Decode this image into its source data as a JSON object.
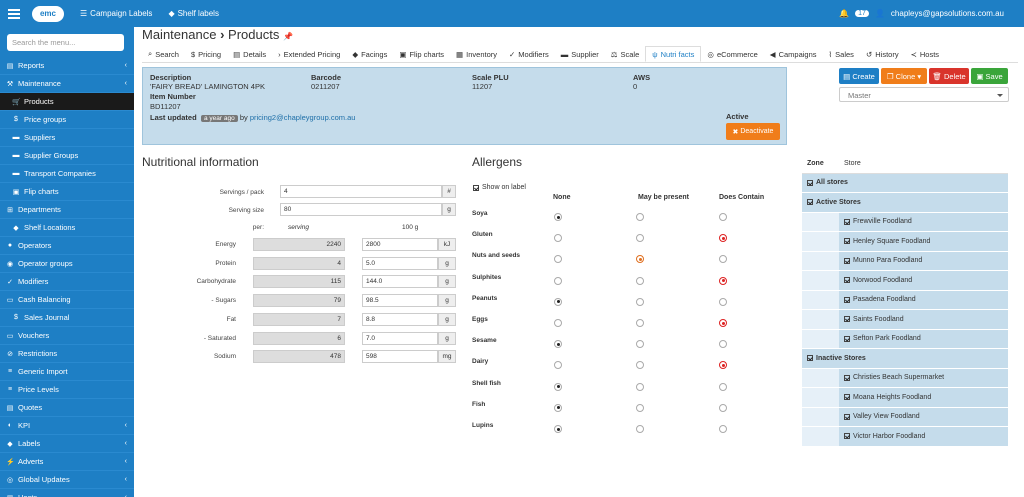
{
  "topbar": {
    "campaign_labels": "Campaign Labels",
    "shelf_labels": "Shelf labels",
    "notif_count": "17",
    "user_email": "chapleys@gapsolutions.com.au",
    "logo": "emc"
  },
  "sidebar": {
    "search_placeholder": "Search the menu...",
    "items": [
      {
        "label": "Reports",
        "icon": "file-icon",
        "arrow": true,
        "sub": false
      },
      {
        "label": "Maintenance",
        "icon": "wrench-icon",
        "arrow": true,
        "sub": false
      },
      {
        "label": "Products",
        "icon": "cart-icon",
        "arrow": false,
        "sub": true,
        "active": true
      },
      {
        "label": "Price groups",
        "icon": "dollar-icon",
        "arrow": false,
        "sub": true
      },
      {
        "label": "Suppliers",
        "icon": "truck-icon",
        "arrow": false,
        "sub": true
      },
      {
        "label": "Supplier Groups",
        "icon": "truck-icon",
        "arrow": false,
        "sub": true
      },
      {
        "label": "Transport Companies",
        "icon": "truck-icon",
        "arrow": false,
        "sub": true
      },
      {
        "label": "Flip charts",
        "icon": "image-icon",
        "arrow": false,
        "sub": true
      },
      {
        "label": "Departments",
        "icon": "sitemap-icon",
        "arrow": false,
        "sub": false
      },
      {
        "label": "Shelf Locations",
        "icon": "tag-icon",
        "arrow": false,
        "sub": true
      },
      {
        "label": "Operators",
        "icon": "user-icon",
        "arrow": false,
        "sub": false
      },
      {
        "label": "Operator groups",
        "icon": "users-icon",
        "arrow": false,
        "sub": false
      },
      {
        "label": "Modifiers",
        "icon": "check-icon",
        "arrow": false,
        "sub": false
      },
      {
        "label": "Cash Balancing",
        "icon": "money-icon",
        "arrow": false,
        "sub": false
      },
      {
        "label": "Sales Journal",
        "icon": "dollar-icon",
        "arrow": false,
        "sub": true
      },
      {
        "label": "Vouchers",
        "icon": "ticket-icon",
        "arrow": false,
        "sub": false
      },
      {
        "label": "Restrictions",
        "icon": "ban-icon",
        "arrow": false,
        "sub": false
      },
      {
        "label": "Generic Import",
        "icon": "list-icon",
        "arrow": false,
        "sub": false
      },
      {
        "label": "Price Levels",
        "icon": "list-icon",
        "arrow": false,
        "sub": false
      },
      {
        "label": "Quotes",
        "icon": "file-icon",
        "arrow": false,
        "sub": false
      },
      {
        "label": "KPI",
        "icon": "gauge-icon",
        "arrow": true,
        "sub": false
      },
      {
        "label": "Labels",
        "icon": "tag-icon",
        "arrow": true,
        "sub": false
      },
      {
        "label": "Adverts",
        "icon": "bolt-icon",
        "arrow": true,
        "sub": false
      },
      {
        "label": "Global Updates",
        "icon": "globe-icon",
        "arrow": true,
        "sub": false
      },
      {
        "label": "Hosts",
        "icon": "server-icon",
        "arrow": true,
        "sub": false
      }
    ]
  },
  "page": {
    "section": "Maintenance",
    "title": "Products"
  },
  "tabs": [
    "Search",
    "Pricing",
    "Details",
    "Extended Pricing",
    "Facings",
    "Flip charts",
    "Inventory",
    "Modifiers",
    "Supplier",
    "Scale",
    "Nutri facts",
    "eCommerce",
    "Campaigns",
    "Sales",
    "History",
    "Hosts"
  ],
  "product": {
    "desc_label": "Description",
    "desc": "'FAIRY BREAD' LAMINGTON 4PK",
    "barcode_label": "Barcode",
    "barcode": "0211207",
    "plu_label": "Scale PLU",
    "plu": "11207",
    "aws_label": "AWS",
    "aws": "0",
    "item_label": "Item Number",
    "item": "BD11207",
    "updated_label": "Last updated",
    "updated_ago": "a year ago",
    "updated_by_word": "by",
    "updated_by": "pricing2@chapleygroup.com.au",
    "active_label": "Active",
    "deactivate": "Deactivate"
  },
  "actions": {
    "create": "Create",
    "clone": "Clone",
    "delete": "Delete",
    "save": "Save",
    "scope": "Master"
  },
  "nutrition": {
    "heading": "Nutritional information",
    "servings_label": "Servings / pack",
    "servings": "4",
    "servings_unit": "#",
    "size_label": "Serving size",
    "size": "80",
    "size_unit": "g",
    "per_label": "per:",
    "per_serving": "serving",
    "per_100": "100 g",
    "rows": [
      {
        "label": "Energy",
        "serving": "2240",
        "per100": "2800",
        "unit": "kJ"
      },
      {
        "label": "Protein",
        "serving": "4",
        "per100": "5.0",
        "unit": "g"
      },
      {
        "label": "Carbohydrate",
        "serving": "115",
        "per100": "144.0",
        "unit": "g"
      },
      {
        "label": "- Sugars",
        "serving": "79",
        "per100": "98.5",
        "unit": "g"
      },
      {
        "label": "Fat",
        "serving": "7",
        "per100": "8.8",
        "unit": "g"
      },
      {
        "label": "- Saturated",
        "serving": "6",
        "per100": "7.0",
        "unit": "g"
      },
      {
        "label": "Sodium",
        "serving": "478",
        "per100": "598",
        "unit": "mg"
      }
    ]
  },
  "allergens": {
    "heading": "Allergens",
    "show_label": "Show on label",
    "col_none": "None",
    "col_maybe": "May be present",
    "col_contains": "Does Contain",
    "rows": [
      {
        "name": "Soya",
        "state": "none"
      },
      {
        "name": "Gluten",
        "state": "contains"
      },
      {
        "name": "Nuts and seeds",
        "state": "maybe"
      },
      {
        "name": "Sulphites",
        "state": "contains"
      },
      {
        "name": "Peanuts",
        "state": "none"
      },
      {
        "name": "Eggs",
        "state": "contains"
      },
      {
        "name": "Sesame",
        "state": "none"
      },
      {
        "name": "Dairy",
        "state": "contains"
      },
      {
        "name": "Shell fish",
        "state": "none"
      },
      {
        "name": "Fish",
        "state": "none"
      },
      {
        "name": "Lupins",
        "state": "none"
      }
    ]
  },
  "zones": {
    "col_zone": "Zone",
    "col_store": "Store",
    "all": "All stores",
    "active": "Active Stores",
    "inactive": "Inactive Stores",
    "active_stores": [
      "Frewville Foodland",
      "Henley Square Foodland",
      "Munno Para Foodland",
      "Norwood Foodland",
      "Pasadena Foodland",
      "Saints Foodland",
      "Sefton Park Foodland"
    ],
    "inactive_stores": [
      "Christies Beach Supermarket",
      "Moana Heights Foodland",
      "Valley View Foodland",
      "Victor Harbor Foodland"
    ]
  },
  "colors": {
    "primary": "#1e7fc5",
    "create": "#1e7fc5",
    "clone": "#f07d1a",
    "delete": "#d9342b",
    "save": "#3aa53a",
    "deactivate": "#f07d1a"
  }
}
